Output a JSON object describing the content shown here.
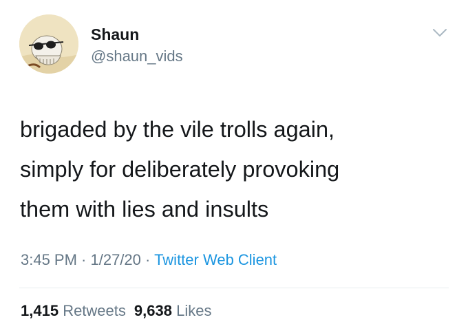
{
  "user": {
    "display_name": "Shaun",
    "handle": "@shaun_vids",
    "avatar_icon": "skull-with-sunglasses-avatar"
  },
  "menu_icon": "chevron-down-icon",
  "tweet": {
    "lines": [
      "brigaded by the vile trolls again,",
      "simply for deliberately provoking",
      "them with lies and insults"
    ]
  },
  "meta": {
    "time": "3:45 PM",
    "separator": " · ",
    "date": "1/27/20",
    "source": "Twitter Web Client"
  },
  "stats": {
    "retweets_count": "1,415",
    "retweets_label": "Retweets",
    "likes_count": "9,638",
    "likes_label": "Likes"
  },
  "colors": {
    "text": "#14171a",
    "secondary": "#657786",
    "link": "#1b95e0",
    "divider": "#e6ecf0"
  }
}
